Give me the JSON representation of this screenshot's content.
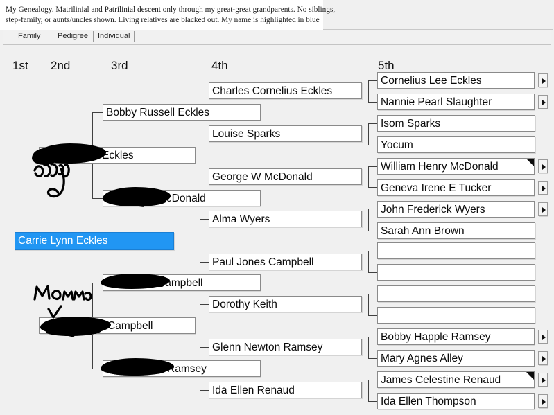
{
  "caption": {
    "line1": "My Genealogy. Matrilinial and Patrilinial descent only through my great-great grandparents. No siblings,",
    "line2": "step-family, or aunts/uncles shown. Living relatives are blacked out. My name is highlighted in blue"
  },
  "tabs": [
    {
      "label": "Family"
    },
    {
      "label": "Pedigree"
    },
    {
      "label": "Individual"
    }
  ],
  "generation_headers": [
    {
      "label": "1st"
    },
    {
      "label": "2nd"
    },
    {
      "label": "3rd"
    },
    {
      "label": "4th"
    },
    {
      "label": "5th"
    }
  ],
  "colors": {
    "selected_highlight": "#2196f3",
    "selected_text": "#ffffff",
    "background": "#f0f0f0",
    "box_background": "#ffffff",
    "box_border": "#8a8a8a",
    "connector": "#404040",
    "redaction": "#000000"
  },
  "annotations": [
    {
      "text": "Daddy",
      "kind": "handwritten-note"
    },
    {
      "text": "Momma",
      "kind": "handwritten-note"
    }
  ],
  "people": {
    "gen1": [
      {
        "name": "Carrie Lynn Eckles",
        "selected": true,
        "redacted": false,
        "expandable": false
      }
    ],
    "gen2": [
      {
        "name": "Eckles",
        "selected": false,
        "redacted": true,
        "expandable": false,
        "note": "Daddy"
      },
      {
        "name": "Campbell",
        "selected": false,
        "redacted": true,
        "expandable": false,
        "note": "Momma"
      }
    ],
    "gen3": [
      {
        "name": "Bobby Russell Eckles",
        "selected": false,
        "redacted": false,
        "expandable": false
      },
      {
        "name": "McDonald",
        "selected": false,
        "redacted": true,
        "expandable": false
      },
      {
        "name": "Campbell",
        "selected": false,
        "redacted": true,
        "expandable": false
      },
      {
        "name": "Ramsey",
        "selected": false,
        "redacted": true,
        "expandable": false
      }
    ],
    "gen4": [
      {
        "name": "Charles Cornelius Eckles",
        "selected": false,
        "redacted": false,
        "expandable": false
      },
      {
        "name": "Louise Sparks",
        "selected": false,
        "redacted": false,
        "expandable": false
      },
      {
        "name": "George W McDonald",
        "selected": false,
        "redacted": false,
        "expandable": false
      },
      {
        "name": "Alma Wyers",
        "selected": false,
        "redacted": false,
        "expandable": false
      },
      {
        "name": "Paul Jones Campbell",
        "selected": false,
        "redacted": false,
        "expandable": false
      },
      {
        "name": "Dorothy Keith",
        "selected": false,
        "redacted": false,
        "expandable": false
      },
      {
        "name": "Glenn Newton Ramsey",
        "selected": false,
        "redacted": false,
        "expandable": false
      },
      {
        "name": "Ida Ellen Renaud",
        "selected": false,
        "redacted": false,
        "expandable": false
      }
    ],
    "gen5": [
      {
        "name": "Cornelius Lee Eckles",
        "expandable": true,
        "corner_marker": false
      },
      {
        "name": "Nannie Pearl Slaughter",
        "expandable": true,
        "corner_marker": false
      },
      {
        "name": "Isom Sparks",
        "expandable": false,
        "corner_marker": false
      },
      {
        "name": "Yocum",
        "expandable": false,
        "corner_marker": false
      },
      {
        "name": "William Henry McDonald",
        "expandable": true,
        "corner_marker": true
      },
      {
        "name": "Geneva Irene E Tucker",
        "expandable": true,
        "corner_marker": false
      },
      {
        "name": "John Frederick Wyers",
        "expandable": true,
        "corner_marker": false
      },
      {
        "name": "Sarah Ann Brown",
        "expandable": false,
        "corner_marker": false
      },
      {
        "name": "",
        "expandable": false,
        "corner_marker": false
      },
      {
        "name": "",
        "expandable": false,
        "corner_marker": false
      },
      {
        "name": "",
        "expandable": false,
        "corner_marker": false
      },
      {
        "name": "",
        "expandable": false,
        "corner_marker": false
      },
      {
        "name": "Bobby Happle Ramsey",
        "expandable": true,
        "corner_marker": false
      },
      {
        "name": "Mary Agnes Alley",
        "expandable": true,
        "corner_marker": false
      },
      {
        "name": "James Celestine Renaud",
        "expandable": true,
        "corner_marker": true
      },
      {
        "name": "Ida Ellen Thompson",
        "expandable": true,
        "corner_marker": false
      }
    ]
  }
}
